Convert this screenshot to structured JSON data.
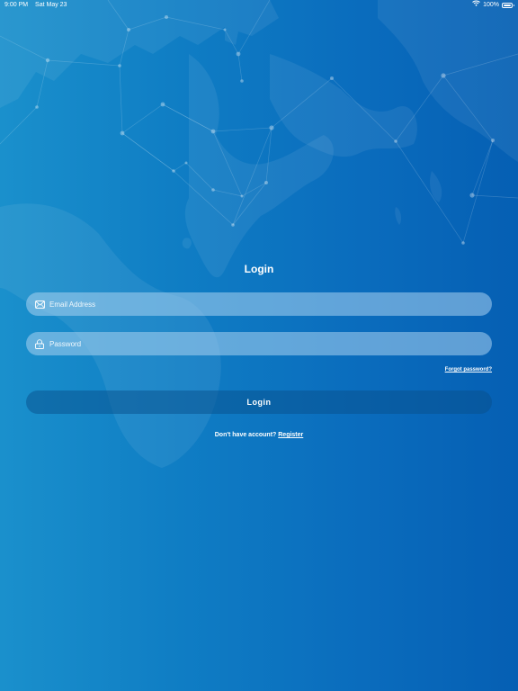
{
  "status_bar": {
    "time": "9:00 PM",
    "date": "Sat May 23",
    "battery": "100%",
    "battery_level": 1.0,
    "wifi_icon": "wifi-icon",
    "battery_icon": "battery-icon"
  },
  "login": {
    "title": "Login",
    "email_placeholder": "Email Address",
    "email_icon": "envelope-icon",
    "password_placeholder": "Password",
    "password_icon": "lock-icon",
    "forgot_password": "Forgot password?",
    "login_button": "Login",
    "no_account_text": "Don't have account?",
    "register_link": "Register"
  },
  "colors": {
    "background_start": "#1a90cc",
    "background_end": "#055fb3",
    "text": "#ffffff"
  }
}
